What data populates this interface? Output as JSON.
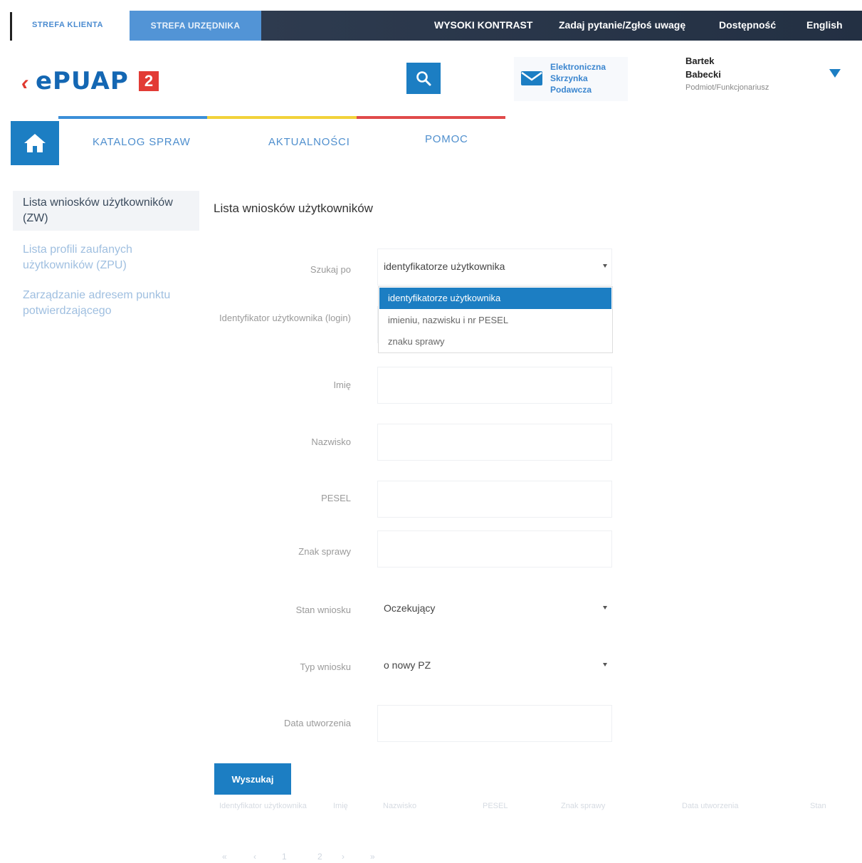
{
  "topbar": {
    "tab_klient": "STREFA KLIENTA",
    "tab_urzednik": "STREFA URZĘDNIKA",
    "links": [
      {
        "label": "WYSOKI KONTRAST"
      },
      {
        "label": "Zadaj pytanie/Zgłoś uwagę"
      },
      {
        "label": "Dostępność"
      },
      {
        "label": "English"
      }
    ]
  },
  "header": {
    "logo_text": "ePUAP",
    "logo_badge": "2",
    "esp_label": "Elektroniczna Skrzynka Podawcza",
    "user_name_first": "Bartek",
    "user_name_last": "Babecki",
    "user_role": "Podmiot/Funkcjonariusz",
    "colors": {
      "accent": "#1c7ec3",
      "brand_red": "#e23b35",
      "dark_bar": "#2b384b"
    }
  },
  "nav": {
    "items": [
      {
        "label": "KATALOG SPRAW"
      },
      {
        "label": "AKTUALNOŚCI"
      },
      {
        "label": "POMOC"
      }
    ]
  },
  "sidebar": {
    "items": [
      {
        "label": "Lista wniosków użytkowników (ZW)",
        "active": true
      },
      {
        "label": "Lista profili zaufanych użytkowników (ZPU)",
        "active": false
      },
      {
        "label": "Zarządzanie adresem punktu potwierdzającego",
        "active": false
      }
    ]
  },
  "main": {
    "title": "Lista wniosków użytkowników",
    "form": {
      "szukaj_po_label": "Szukaj po",
      "szukaj_po_value": "identyfikatorze użytkownika",
      "dropdown_options": [
        "identyfikatorze użytkownika",
        "imieniu, nazwisku i nr PESEL",
        "znaku sprawy"
      ],
      "identyfikator_label": "Identyfikator użytkownika (login)",
      "imie_label": "Imię",
      "nazwisko_label": "Nazwisko",
      "pesel_label": "PESEL",
      "znak_label": "Znak sprawy",
      "stan_label": "Stan wniosku",
      "stan_value": "Oczekujący",
      "typ_label": "Typ wniosku",
      "typ_value": "o nowy PZ",
      "data_label": "Data utworzenia",
      "submit": "Wyszukaj"
    },
    "table_headers": [
      "Identyfikator użytkownika",
      "Imię",
      "Nazwisko",
      "PESEL",
      "Znak sprawy",
      "Data utworzenia",
      "Stan"
    ],
    "pager": [
      "«",
      "‹",
      "1",
      "2",
      "›",
      "»"
    ]
  }
}
